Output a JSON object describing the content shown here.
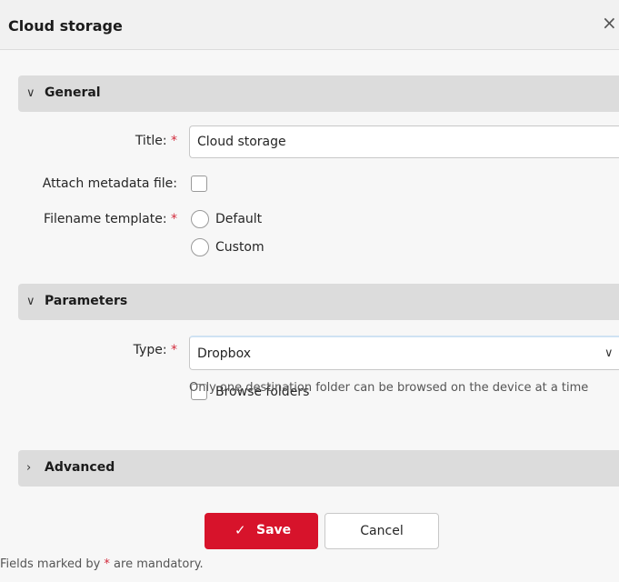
{
  "dialog": {
    "title": "Cloud storage",
    "close_icon": "×"
  },
  "sections": {
    "general": {
      "chevron": "∨",
      "title": "General"
    },
    "parameters": {
      "chevron": "∨",
      "title": "Parameters"
    },
    "advanced": {
      "chevron": "›",
      "title": "Advanced"
    }
  },
  "fields": {
    "title": {
      "label": "Title:",
      "required_mark": "*",
      "value": "Cloud storage"
    },
    "attach_metadata": {
      "label": "Attach metadata file:",
      "checked": false
    },
    "filename_template": {
      "label": "Filename template:",
      "required_mark": "*",
      "options": [
        "Default",
        "Custom"
      ]
    },
    "type": {
      "label": "Type:",
      "required_mark": "*",
      "value": "Dropbox",
      "arrow": "∨"
    },
    "browse_folders": {
      "label": "Browse folders",
      "checked": false
    },
    "hint": "Only one destination folder can be browsed on the device at a time"
  },
  "buttons": {
    "save_icon": "✓",
    "save_label": "Save",
    "cancel_label": "Cancel"
  },
  "footer": {
    "prefix": "Fields marked by ",
    "mark": "*",
    "suffix": " are mandatory."
  },
  "colors": {
    "accent": "#d7132b",
    "required": "#d22b3c",
    "section_bg": "#dcdcdc"
  }
}
